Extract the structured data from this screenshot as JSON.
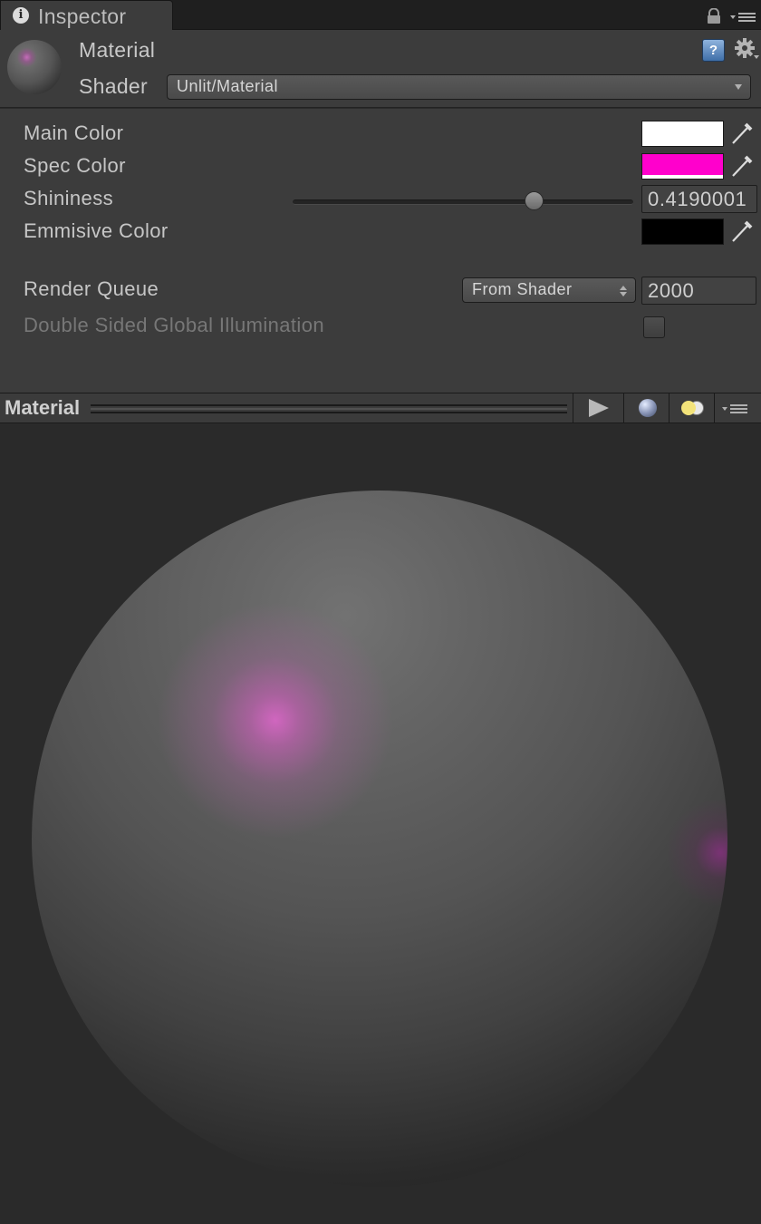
{
  "tab": {
    "title": "Inspector",
    "icon": "info-icon"
  },
  "header": {
    "title": "Material",
    "shader_label": "Shader",
    "shader_value": "Unlit/Material"
  },
  "properties": {
    "main_color": {
      "label": "Main Color",
      "color": "#ffffff"
    },
    "spec_color": {
      "label": "Spec Color",
      "color": "#ff00cc"
    },
    "shininess": {
      "label": "Shininess",
      "value": "0.4190001",
      "slider_fraction": 0.72
    },
    "emissive_color": {
      "label": "Emmisive Color",
      "color": "#000000"
    },
    "render_queue": {
      "label": "Render Queue",
      "mode": "From Shader",
      "value": "2000"
    },
    "double_sided_gi": {
      "label": "Double Sided Global Illumination",
      "checked": false
    }
  },
  "preview": {
    "title": "Material"
  },
  "colors": {
    "panel_bg": "#3c3c3c",
    "preview_bg": "#2a2a2a",
    "spec_highlight": "#d666c4"
  }
}
